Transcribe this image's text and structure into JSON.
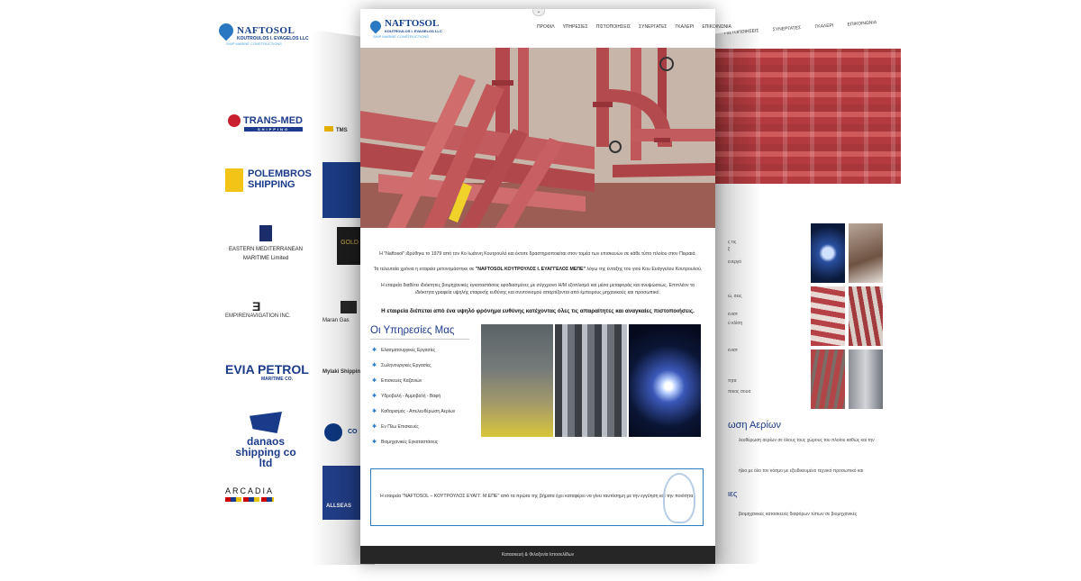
{
  "left_page": {
    "brand": {
      "name": "NAFTOSOL",
      "subtitle": "KOUTROULOS I. EVAGELOS LLC",
      "tagline": "SHIP MARINE CONSTRUCTIONS"
    },
    "partners": {
      "transmed": {
        "name": "TRANS-MED",
        "sub": "SHIPPING"
      },
      "polembros": {
        "line1": "POLEMBROS",
        "line2": "SHIPPING"
      },
      "eastern": {
        "line1": "EASTERN MEDITERRANEAN",
        "line2": "MARITIME Limited"
      },
      "empire": {
        "name": "EMPIRENAVIGATION INC."
      },
      "evia": {
        "name": "EVIA PETROL",
        "sub": "MARITIME CO."
      },
      "danaos": {
        "name": "danaos",
        "sub": "shipping co ltd"
      },
      "arcadia": {
        "name": "ARCADIA"
      },
      "tms": {
        "name": "TMS"
      },
      "gold": {
        "name": "GOLD UNI"
      },
      "maran": {
        "name": "Maran Gas"
      },
      "mylaki": {
        "name": "Mylaki Shipping"
      },
      "co": {
        "name": "CO"
      },
      "allseas": {
        "name": "ALLSEAS"
      }
    }
  },
  "right_page": {
    "nav": [
      "ΠΙΣΤΟΠΟΙΗΣΕΙΣ",
      "ΣΥΝΕΡΓΑΤΕΣ",
      "ΓΚΑΛΕΡΙ",
      "ΕΠΙΚΟΙΝΩΝΙΑ"
    ],
    "text_snippets": [
      "ς τις",
      "ξ",
      "ενεργό",
      "ώ, σεις",
      "ενιστ",
      "ύ κλίση",
      "ενιστ",
      "τητα",
      "ποιος σουα"
    ],
    "heading1": "ωση Αερίων",
    "line1": "λευθέρωση αερίων σε όλους τους χώρους του πλοίου καθώς και την",
    "line2": "ήλιο με όλο τον κόσμο με εξειδικευμένο τεχνικό προσωπικό και",
    "heading2": "ιες",
    "line3": "βιομηχανικές κατασκευές διαφόρων τύπων σε βιομηχανικές"
  },
  "center_page": {
    "brand": {
      "name": "NAFTOSOL",
      "subtitle": "KOUTROULOS I. EVAGELOS LLC",
      "tagline": "SHIP MARINE CONSTRUCTIONS"
    },
    "nav": [
      "ΠΡΟΦΙΛ",
      "ΥΠΗΡΕΣΙΕΣ",
      "ΠΙΣΤΟΠΟΙΗΣΕΙΣ",
      "ΣΥΝΕΡΓΑΤΕΣ",
      "ΓΚΑΛΕΡΙ",
      "ΕΠΙΚΟΙΝΩΝΙΑ"
    ],
    "intro": {
      "p1": "Η \"Naftosol\" ιδρύθηκε το 1979 από τον Κο Ιωάννη Κουτρουλό και έκτοτε δραστηριοποιείται στον τομέα των επισκευών σε κάθε τύπο πλοίου στον Πειραιά.",
      "p2_pre": "Τα τελευταία χρόνια η εταιρεία μετονομάστηκε σε ",
      "p2_bold": "\"NAFTOSOL ΚΟΥΤΡΟΥΛΟΣ Ι. ΕΥΑΓΓΕΛΟΣ ΜΕΠΕ\"",
      "p2_post": " λόγω της ένταξης του γιού Κου Ευάγγελου Κουτρουλού.",
      "p3a": "Η εταιρεία διαθέτει ιδιόκτητες βιομηχανικές εγκαταστάσεις εφοδιασμένες με σύγχρονο Η/Μ εξοπλισμό και μέσα μεταφοράς και ανυψώσεως. Επιπλέον τα",
      "p3b": "ιδιόκτητα γραφεία υψηλής εταιρικής ευθύνης και συντονισμού απαρτίζονται από έμπειρους μηχανικούς και προσωπικό.",
      "bold": "Η εταιρεία διέπεται από ένα υψηλό φρόνημα ευθύνης κατέχοντας όλες τις απαραίτητες και αναγκαίες πιστοποιήσεις."
    },
    "services": {
      "title": "Οι Υπηρεσίες Μας",
      "items": [
        "Ελασματουργικές Εργασίες",
        "Σωληνουργικές Εργασίες",
        "Επισκευές Καζανιών",
        "Υδροβολή - Αμμοβολή - Βαφή",
        "Καθαρισμός - Απελευθέρωση Αερίων",
        "Εν Πλω Επισκευές",
        "Βιομηχανικές Εγκαταστάσεις"
      ]
    },
    "quote": "Η εταιρεία \"NAFTOSOL – ΚΟΥΤΡΟΥΛΟΣ ΕΥΑΓΓ. Μ.ΕΠΕ\" από τα πρώτα της βήματα έχει καταφέρει να γίνει ταυτόσημη με την εγγύηση και την ποιότητα.",
    "footer": "Κατασκευή & Φιλοξενία Ιστοσελίδων"
  }
}
